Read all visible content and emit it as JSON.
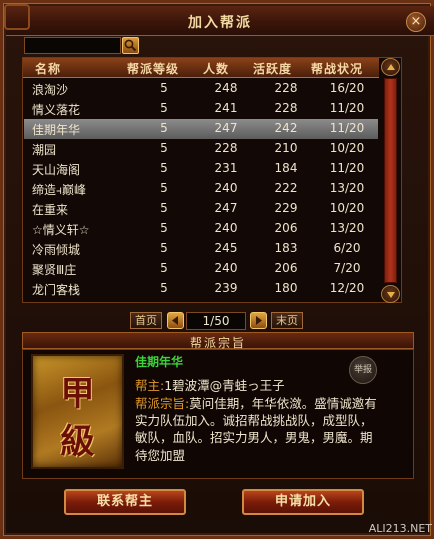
{
  "window": {
    "title": "加入帮派",
    "close_label": "×"
  },
  "table": {
    "headers": [
      "名称",
      "帮派等级",
      "人数",
      "活跃度",
      "帮战状况"
    ],
    "rows": [
      {
        "name": "浪淘沙",
        "level": "5",
        "members": "248",
        "activity": "228",
        "war": "16/20"
      },
      {
        "name": "情义落花",
        "level": "5",
        "members": "241",
        "activity": "228",
        "war": "11/20"
      },
      {
        "name": "佳期年华",
        "level": "5",
        "members": "247",
        "activity": "242",
        "war": "11/20"
      },
      {
        "name": "潮园",
        "level": "5",
        "members": "228",
        "activity": "210",
        "war": "10/20"
      },
      {
        "name": "天山海阁",
        "level": "5",
        "members": "231",
        "activity": "184",
        "war": "11/20"
      },
      {
        "name": "缔造⫞巅峰",
        "level": "5",
        "members": "240",
        "activity": "222",
        "war": "13/20"
      },
      {
        "name": "在重来",
        "level": "5",
        "members": "247",
        "activity": "229",
        "war": "10/20"
      },
      {
        "name": "☆情义轩☆",
        "level": "5",
        "members": "240",
        "activity": "206",
        "war": "13/20"
      },
      {
        "name": "冷雨倾城",
        "level": "5",
        "members": "245",
        "activity": "183",
        "war": "6/20"
      },
      {
        "name": "聚贤Ⅲ庄",
        "level": "5",
        "members": "240",
        "activity": "206",
        "war": "7/20"
      },
      {
        "name": "龙门客栈",
        "level": "5",
        "members": "239",
        "activity": "180",
        "war": "12/20"
      }
    ]
  },
  "pager": {
    "first": "首页",
    "last": "末页",
    "page": "1/50"
  },
  "detail": {
    "section_title": "帮派宗旨",
    "guild_name": "佳期年华",
    "leader_label": "帮主:",
    "leader_value": "1碧波潭@青蛙っ王子",
    "motto_label": "帮派宗旨:",
    "motto_text": "莫问佳期，年华依潋。盛情诚邀有实力队伍加入。诚招帮战挑战队，成型队，敏队，血队。招实力男人，男鬼，男魔。期待您加盟",
    "emblem_chars": [
      "甲",
      "級"
    ],
    "report_label": "举报"
  },
  "actions": {
    "contact": "联系帮主",
    "apply": "申请加入"
  },
  "watermark": "ALI213.NET",
  "colors": {
    "accent": "#e09a2a",
    "guild_name": "#3cd23a",
    "selected_row": "#7a7a7a"
  }
}
